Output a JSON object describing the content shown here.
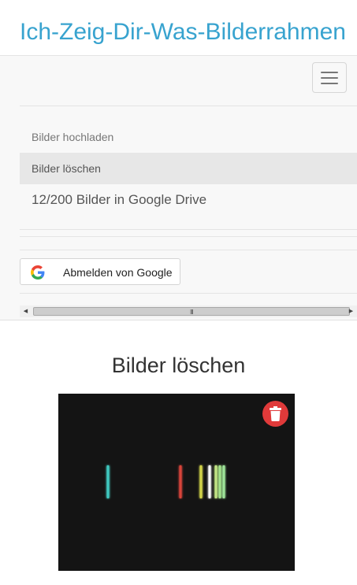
{
  "header": {
    "title": "Ich-Zeig-Dir-Was-Bilderrahmen"
  },
  "nav": {
    "items": [
      {
        "label": "Bilder hochladen",
        "active": false
      },
      {
        "label": "Bilder löschen",
        "active": true
      }
    ],
    "status": "12/200 Bilder in Google Drive",
    "google_button": {
      "label": "Abmelden von Google",
      "icon": "google-g-icon"
    },
    "scrollbar": {
      "grip": "III"
    }
  },
  "main": {
    "title": "Bilder löschen",
    "photo": {
      "delete_icon": "trash-icon"
    }
  },
  "colors": {
    "accent": "#38a3cf",
    "delete": "#e03a3a",
    "photo_bg": "#141414"
  }
}
